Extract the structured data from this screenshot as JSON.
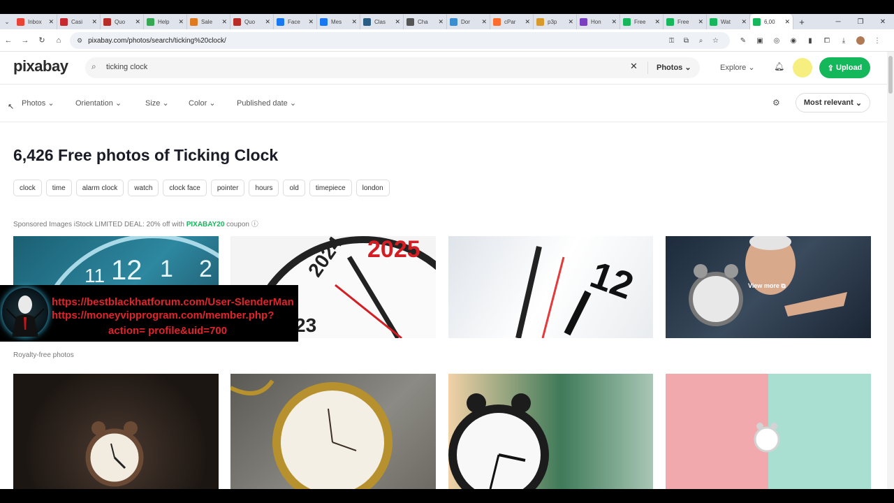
{
  "browser": {
    "tabs": [
      {
        "title": "Inbox",
        "icon": "gmail-icon",
        "color": "#ea4335"
      },
      {
        "title": "Casi",
        "icon": "site-icon",
        "color": "#c7282e"
      },
      {
        "title": "Quo",
        "icon": "quora-icon",
        "color": "#b92b27"
      },
      {
        "title": "Help",
        "icon": "help-icon",
        "color": "#34a853"
      },
      {
        "title": "Sale",
        "icon": "sale-icon",
        "color": "#e07a1f"
      },
      {
        "title": "Quo",
        "icon": "quora-icon",
        "color": "#b92b27"
      },
      {
        "title": "Face",
        "icon": "facebook-icon",
        "color": "#1877f2"
      },
      {
        "title": "Mes",
        "icon": "facebook-icon",
        "color": "#1877f2"
      },
      {
        "title": "Clas",
        "icon": "site-icon",
        "color": "#2a5d84"
      },
      {
        "title": "Cha",
        "icon": "chat-icon",
        "color": "#555555"
      },
      {
        "title": "Dor",
        "icon": "globe-icon",
        "color": "#3b8fd1"
      },
      {
        "title": "cPar",
        "icon": "cpanel-icon",
        "color": "#ff6c2c"
      },
      {
        "title": "p3p",
        "icon": "site-icon",
        "color": "#d89b2b"
      },
      {
        "title": "Hon",
        "icon": "home-icon",
        "color": "#7b3fc4"
      },
      {
        "title": "Free",
        "icon": "pixabay-icon",
        "color": "#14b85a"
      },
      {
        "title": "Free",
        "icon": "pixabay-icon",
        "color": "#14b85a"
      },
      {
        "title": "Wat",
        "icon": "pixabay-icon",
        "color": "#14b85a"
      },
      {
        "title": "6,00",
        "icon": "pixabay-icon",
        "color": "#14b85a",
        "active": true
      }
    ],
    "new_tab": "+",
    "url": "pixabay.com/photos/search/ticking%20clock/"
  },
  "header": {
    "logo": "pixabay",
    "search_value": "ticking clock",
    "search_type": "Photos",
    "explore": "Explore",
    "upload": "Upload"
  },
  "filters": {
    "items": [
      "Photos",
      "Orientation",
      "Size",
      "Color",
      "Published date"
    ],
    "sort": "Most relevant"
  },
  "main": {
    "title": "6,426 Free photos of Ticking Clock",
    "tags": [
      "clock",
      "time",
      "alarm clock",
      "watch",
      "clock face",
      "pointer",
      "hours",
      "old",
      "timepiece",
      "london"
    ],
    "sponsored_prefix": "Sponsored Images iStock LIMITED DEAL: 20% off with",
    "sponsored_code": "PIXABAY20",
    "sponsored_suffix": "coupon",
    "royalty_free": "Royalty-free photos",
    "view_more": "View more",
    "photo_year_new": "2025",
    "photo_year_old": "2024",
    "photo_year_partial": "23"
  },
  "overlay": {
    "line1": "https://bestblackhatforum.com/User-SlenderMan",
    "line2": "https://moneyvipprogram.com/member.php?",
    "line3": "action= profile&uid=700"
  },
  "colors": {
    "accent": "#14b85a",
    "overlay_text": "#e1232b"
  }
}
